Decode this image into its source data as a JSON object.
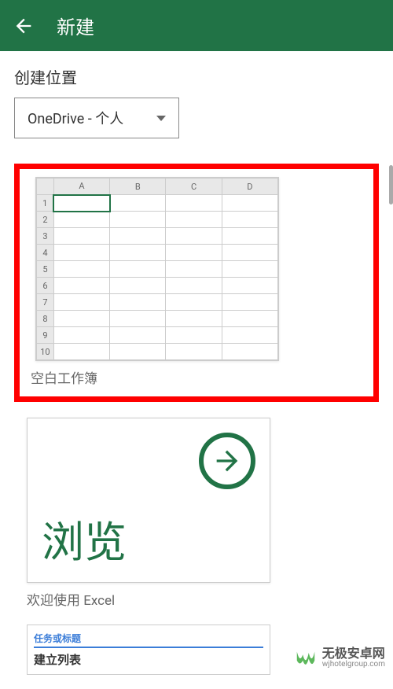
{
  "header": {
    "title": "新建"
  },
  "location": {
    "label": "创建位置",
    "selected": "OneDrive - 个人"
  },
  "templates": {
    "blank": {
      "label": "空白工作簿",
      "columns": [
        "A",
        "B",
        "C",
        "D"
      ],
      "rows": [
        "1",
        "2",
        "3",
        "4",
        "5",
        "6",
        "7",
        "8",
        "9",
        "10"
      ]
    },
    "browse": {
      "text": "浏览",
      "label": "欢迎使用 Excel"
    },
    "list": {
      "task_title": "任务或标题",
      "establish": "建立列表"
    }
  },
  "watermark": {
    "cn": "无极安卓网",
    "en": "wjhotelgroup.com"
  }
}
